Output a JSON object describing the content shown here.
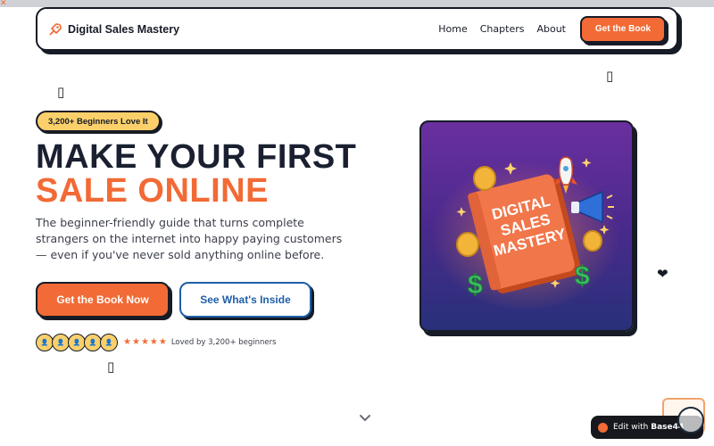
{
  "colors": {
    "accent": "#f26a35",
    "dark": "#161b26",
    "badge_yellow": "#fbd06b",
    "link_blue": "#1f5fa8"
  },
  "nav": {
    "brand_icon": "rocket-icon",
    "brand": "Digital Sales Mastery",
    "links": [
      "Home",
      "Chapters",
      "About"
    ],
    "cta": "Get the Book"
  },
  "hero": {
    "badge": "3,200+ Beginners Love It",
    "headline_line1": "MAKE YOUR FIRST",
    "headline_line2": "SALE ONLINE",
    "subtitle": "The beginner-friendly guide that turns complete strangers on the internet into happy paying customers — even if you've never sold anything online before.",
    "primary_button": "Get the Book Now",
    "secondary_button": "See What's Inside",
    "avatars": [
      "👤",
      "👤",
      "👤",
      "👤",
      "👤"
    ],
    "rating_stars": 5,
    "social_proof": "Loved by 3,200+ beginners"
  },
  "book_cover": {
    "title_lines": [
      "DIGITAL",
      "SALES",
      "MASTERY"
    ]
  },
  "decor": {
    "missing_glyph": "▯",
    "heart": "❤"
  },
  "widget": {
    "edit_prefix": "Edit with ",
    "edit_brand": "Base44"
  }
}
